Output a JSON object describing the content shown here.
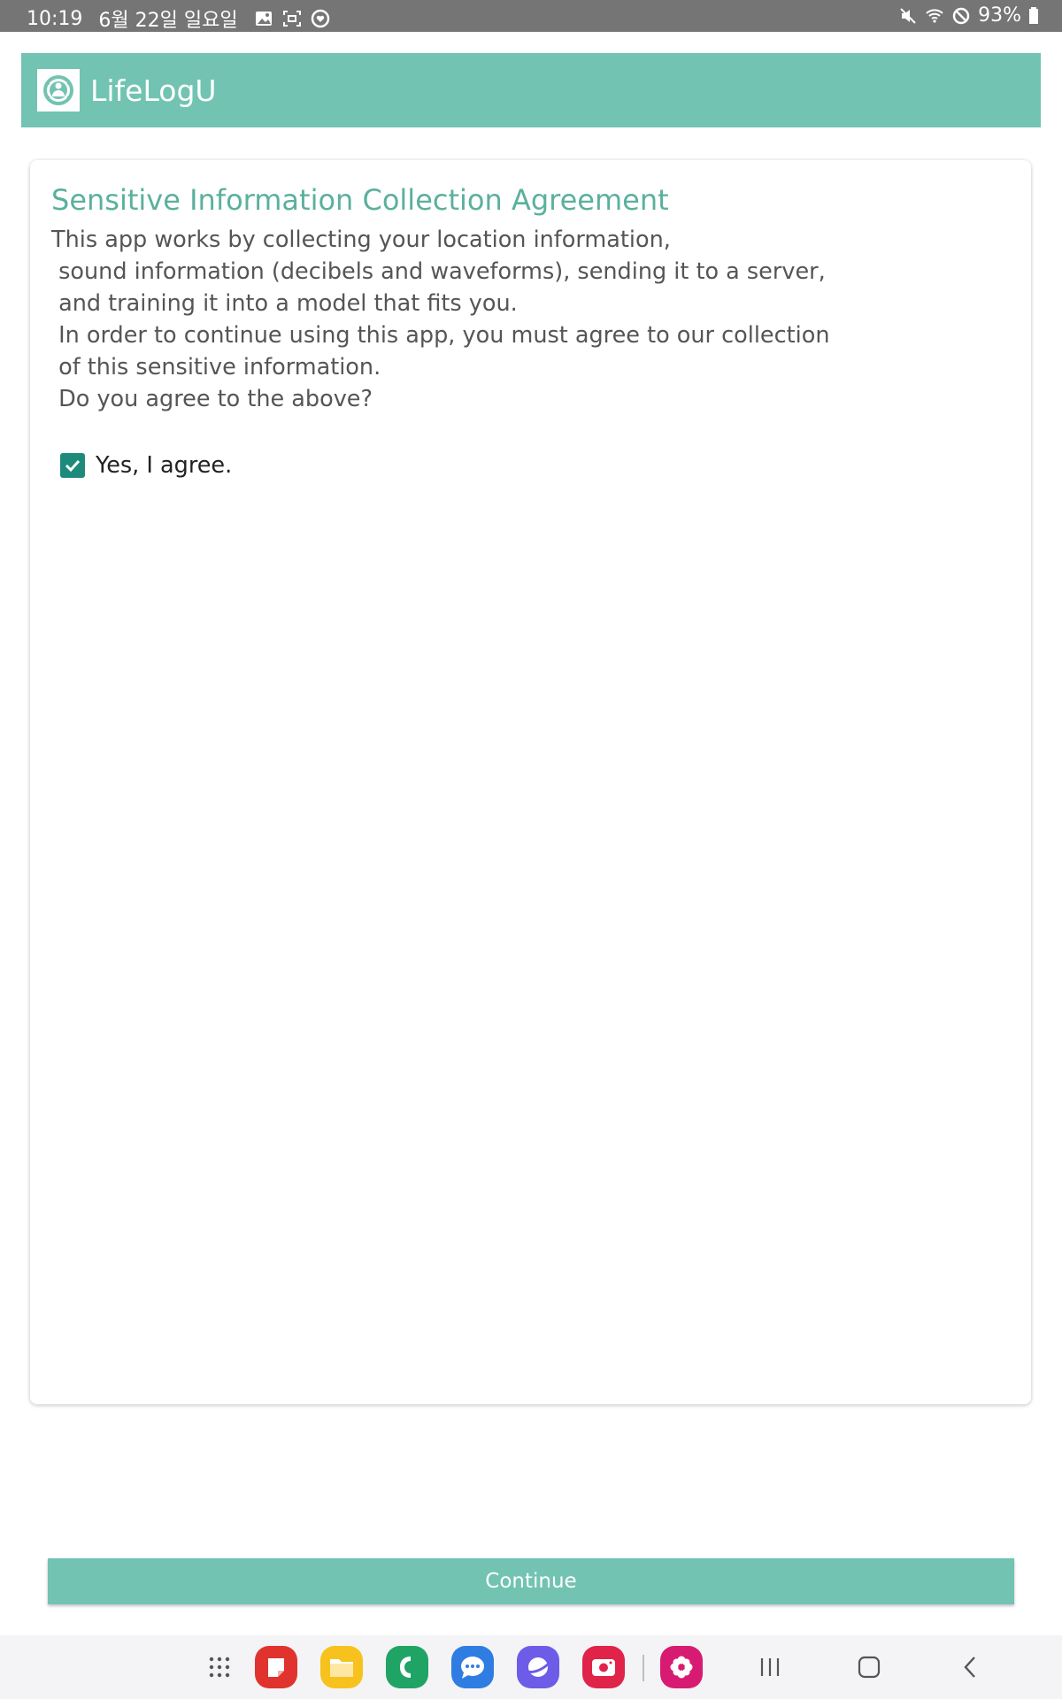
{
  "status_bar": {
    "time": "10:19",
    "date": "6월 22일 일요일",
    "battery": "93%",
    "left_icons": [
      "gallery-icon",
      "screenshot-icon",
      "health-icon"
    ],
    "right_icons": [
      "mute-icon",
      "wifi-icon",
      "dnd-icon",
      "battery-icon"
    ]
  },
  "app_bar": {
    "title": "LifeLogU",
    "logo_icon": "lifelogu-logo-icon",
    "color": "#72c3b2"
  },
  "agreement": {
    "title": "Sensitive Information Collection Agreement",
    "lines": [
      "This app works by collecting your location information,",
      " sound information (decibels and waveforms), sending it to a server,",
      " and training it into a model that fits you.",
      " In order to continue using this app, you must agree to our collection",
      " of this sensitive information.",
      " Do you agree to the above?"
    ],
    "checkbox_label": "Yes, I agree.",
    "checkbox_checked": true,
    "title_color": "#5bb09d",
    "checkbox_color": "#1e8a7b"
  },
  "continue_button": {
    "label": "Continue"
  },
  "nav_bar": {
    "apps": [
      "app-drawer-icon",
      "notes-app-icon",
      "files-app-icon",
      "phone-app-icon",
      "messages-app-icon",
      "internet-app-icon",
      "screen-recorder-app-icon",
      "gallery-app-icon"
    ],
    "controls": [
      "recents-icon",
      "home-icon",
      "back-icon"
    ]
  }
}
